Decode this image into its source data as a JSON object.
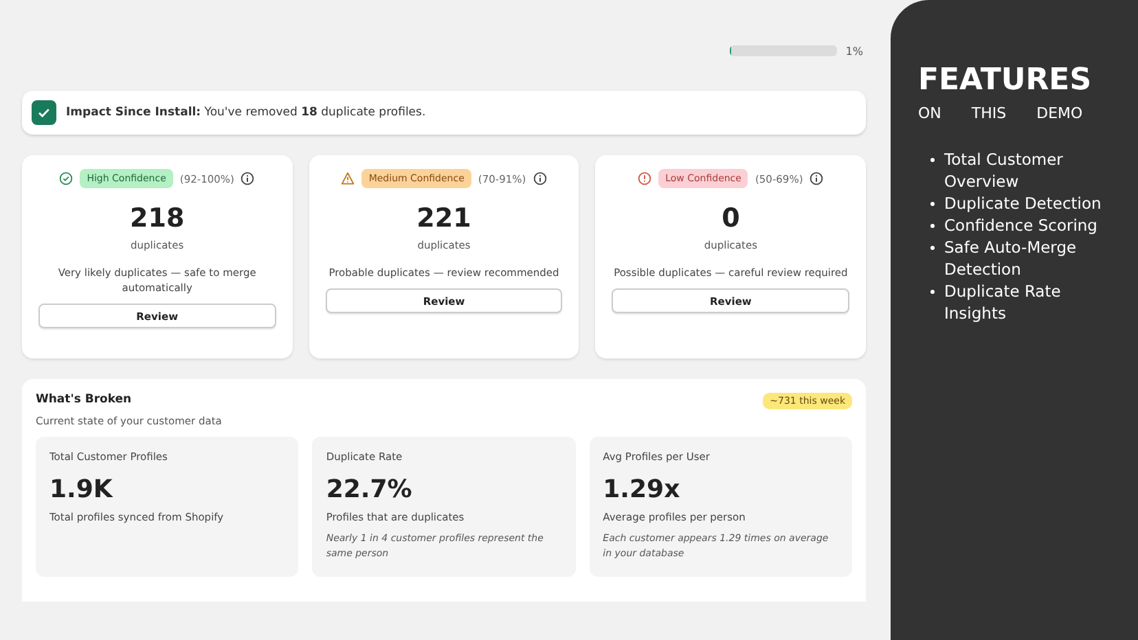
{
  "progress": {
    "level": 0.01,
    "reading": "1%"
  },
  "impact": {
    "text": "**Impact Since Install:** You've removed **18** duplicate profiles."
  },
  "confidence_cards": [
    {
      "kind": "high",
      "badge": "High Confidence",
      "range": "(92-100%)",
      "count": "218",
      "unit": "duplicates",
      "description": "Very likely duplicates — safe to merge automatically",
      "button": "Review"
    },
    {
      "kind": "medium",
      "badge": "Medium Confidence",
      "range": "(70-91%)",
      "count": "221",
      "unit": "duplicates",
      "description": "Probable duplicates — review recommended",
      "button": "Review"
    },
    {
      "kind": "low",
      "badge": "Low Confidence",
      "range": "(50-69%)",
      "count": "0",
      "unit": "duplicates",
      "description": "Possible duplicates — careful review required",
      "button": "Review"
    }
  ],
  "whats_broken": {
    "title": "What's Broken",
    "subtitle": "Current state of your customer data",
    "badge": "~731 this week",
    "stats": [
      {
        "label": "Total Customer Profiles",
        "value": "1.9K",
        "caption": "Total profiles synced from Shopify"
      },
      {
        "label": "Duplicate Rate",
        "value": "22.7%",
        "caption": "Profiles that are duplicates",
        "note": "Nearly 1 in 4 customer profiles represent the same person"
      },
      {
        "label": "Avg Profiles per User",
        "value": "1.29x",
        "caption": "Average profiles per person",
        "note": "Each customer appears 1.29 times on average in your database"
      }
    ]
  },
  "features_panel": {
    "title": "FEATURES",
    "subtitle": [
      "ON",
      "THIS",
      "DEMO"
    ],
    "items": [
      "Total Customer Overview",
      "Duplicate Detection",
      "Confidence Scoring",
      "Safe Auto-Merge Detection",
      "Duplicate Rate Insights"
    ]
  }
}
